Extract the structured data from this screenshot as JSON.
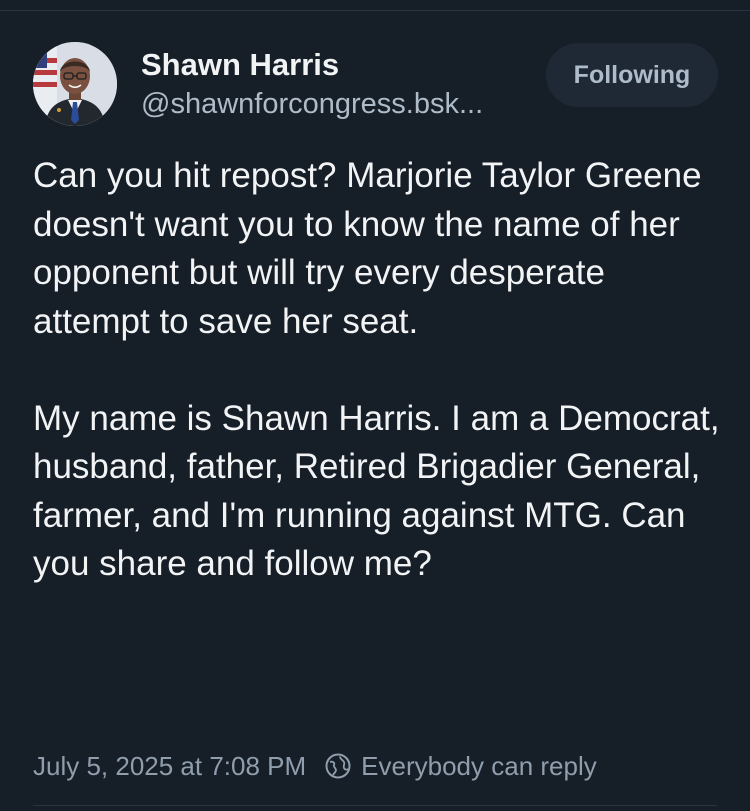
{
  "post": {
    "author": {
      "display_name": "Shawn Harris",
      "handle": "@shawnforcongress.bsk...",
      "avatar": "profile-photo"
    },
    "follow_button": {
      "label": "Following"
    },
    "body": {
      "paragraph_1": "Can you hit repost? Marjorie Taylor Greene doesn't want you to know the name of her opponent but will try every desperate attempt to save her seat.",
      "paragraph_2": "My name is Shawn Harris. I am a Democrat, husband, father, Retired Brigadier General, farmer, and I'm running against MTG. Can you share and follow me?"
    },
    "meta": {
      "timestamp": "July 5, 2025 at 7:08 PM",
      "reply_scope": "Everybody can reply",
      "reply_scope_icon": "globe-icon"
    }
  },
  "colors": {
    "background": "#161e27",
    "text_primary": "#f1f3f5",
    "text_secondary": "#aebbc9",
    "button_bg": "#1e2935"
  }
}
